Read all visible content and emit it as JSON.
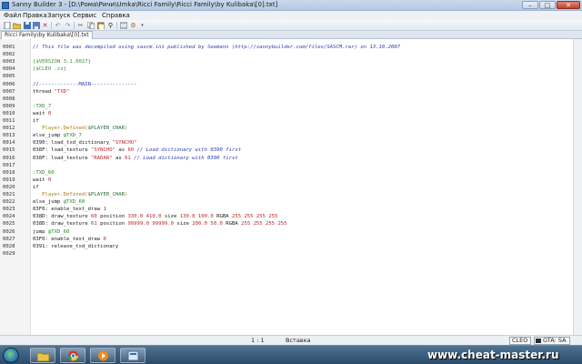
{
  "window": {
    "title": "Sanny Builder 3 - [D:\\Рома\\Ричи\\Umka\\Ricci Family\\Ricci Family\\by Kulibaka\\[0].txt]"
  },
  "menu": [
    "Файл",
    "Правка",
    "Запуск",
    "Сервис",
    "Справка"
  ],
  "tab": {
    "label": "Ricci Family\\by Kulibaka\\[0].txt"
  },
  "colors": {
    "comment": "#2a3fb0",
    "directive": "#3f8f3f",
    "label": "#2a8a2a",
    "string": "#c0262c",
    "class": "#b07a12"
  },
  "code_lines": [
    {
      "num": "0001",
      "segments": [
        {
          "t": "// This file was decompiled using sascm.ini published by Seemann (http://sannybuilder.com/files/SASCM.rar) on 13.10.2007",
          "c": "comment"
        }
      ]
    },
    {
      "num": "0002",
      "segments": []
    },
    {
      "num": "0003",
      "segments": [
        {
          "t": "{$VERSION 3.1.0027}",
          "c": "directive"
        }
      ]
    },
    {
      "num": "0004",
      "segments": [
        {
          "t": "{$CLEO .cs}",
          "c": "directive"
        }
      ]
    },
    {
      "num": "0005",
      "segments": []
    },
    {
      "num": "0006",
      "segments": [
        {
          "t": "//-------------MAIN---------------",
          "c": "sep"
        }
      ]
    },
    {
      "num": "0007",
      "segments": [
        {
          "t": "thread ",
          "c": "plain"
        },
        {
          "t": "\"TXD\"",
          "c": "string"
        }
      ]
    },
    {
      "num": "0008",
      "segments": []
    },
    {
      "num": "0009",
      "segments": [
        {
          "t": ":TXD_7",
          "c": "label"
        }
      ]
    },
    {
      "num": "0010",
      "segments": [
        {
          "t": "wait ",
          "c": "plain"
        },
        {
          "t": "0",
          "c": "number"
        }
      ]
    },
    {
      "num": "0011",
      "segments": [
        {
          "t": "if",
          "c": "plain"
        }
      ]
    },
    {
      "num": "0012",
      "segments": [
        {
          "t": "   Player.Defined(",
          "c": "class"
        },
        {
          "t": "$PLAYER_CHAR",
          "c": "var"
        },
        {
          "t": ")",
          "c": "class"
        }
      ]
    },
    {
      "num": "0013",
      "segments": [
        {
          "t": "else_jump ",
          "c": "plain"
        },
        {
          "t": "@TXD_7",
          "c": "label"
        }
      ]
    },
    {
      "num": "0014",
      "segments": [
        {
          "t": "0390: load_txd_dictionary ",
          "c": "plain"
        },
        {
          "t": "\"SYNCHO\"",
          "c": "string"
        }
      ]
    },
    {
      "num": "0015",
      "segments": [
        {
          "t": "038F: load_texture ",
          "c": "plain"
        },
        {
          "t": "\"SYNCHO\"",
          "c": "string"
        },
        {
          "t": " as ",
          "c": "plain"
        },
        {
          "t": "60",
          "c": "number"
        },
        {
          "t": " // Load dictionary with 0390 first",
          "c": "comment"
        }
      ]
    },
    {
      "num": "0016",
      "segments": [
        {
          "t": "038F: load_texture ",
          "c": "plain"
        },
        {
          "t": "\"RADAR\"",
          "c": "string"
        },
        {
          "t": " as ",
          "c": "plain"
        },
        {
          "t": "61",
          "c": "number"
        },
        {
          "t": " // Load dictionary with 0390 first",
          "c": "comment"
        }
      ]
    },
    {
      "num": "0017",
      "segments": []
    },
    {
      "num": "0018",
      "segments": [
        {
          "t": ":TXD_60",
          "c": "label"
        }
      ]
    },
    {
      "num": "0019",
      "segments": [
        {
          "t": "wait ",
          "c": "plain"
        },
        {
          "t": "0",
          "c": "number"
        }
      ]
    },
    {
      "num": "0020",
      "segments": [
        {
          "t": "if",
          "c": "plain"
        }
      ]
    },
    {
      "num": "0021",
      "segments": [
        {
          "t": "   Player.Defined(",
          "c": "class"
        },
        {
          "t": "$PLAYER_CHAR",
          "c": "var"
        },
        {
          "t": ")",
          "c": "class"
        }
      ]
    },
    {
      "num": "0022",
      "segments": [
        {
          "t": "else_jump ",
          "c": "plain"
        },
        {
          "t": "@TXD_60",
          "c": "label"
        }
      ]
    },
    {
      "num": "0023",
      "segments": [
        {
          "t": "03F0: enable_text_draw ",
          "c": "plain"
        },
        {
          "t": "1",
          "c": "number"
        }
      ]
    },
    {
      "num": "0024",
      "segments": [
        {
          "t": "038D: draw_texture ",
          "c": "plain"
        },
        {
          "t": "60",
          "c": "number"
        },
        {
          "t": " position ",
          "c": "plain"
        },
        {
          "t": "330.0 410.0",
          "c": "number"
        },
        {
          "t": " size ",
          "c": "plain"
        },
        {
          "t": "130.0 100.0",
          "c": "number"
        },
        {
          "t": " RGBA ",
          "c": "plain"
        },
        {
          "t": "255 255 255 255",
          "c": "number"
        }
      ]
    },
    {
      "num": "0025",
      "segments": [
        {
          "t": "038D: draw_texture ",
          "c": "plain"
        },
        {
          "t": "61",
          "c": "number"
        },
        {
          "t": " position ",
          "c": "plain"
        },
        {
          "t": "99999.0 99999.0",
          "c": "number"
        },
        {
          "t": " size ",
          "c": "plain"
        },
        {
          "t": "200.0 50.0",
          "c": "number"
        },
        {
          "t": " RGBA ",
          "c": "plain"
        },
        {
          "t": "255 255 255 255",
          "c": "number"
        }
      ]
    },
    {
      "num": "0026",
      "segments": [
        {
          "t": "jump ",
          "c": "plain"
        },
        {
          "t": "@TXD_60",
          "c": "label"
        }
      ]
    },
    {
      "num": "0027",
      "segments": [
        {
          "t": "03F0: enable_text_draw ",
          "c": "plain"
        },
        {
          "t": "0",
          "c": "number"
        }
      ]
    },
    {
      "num": "0028",
      "segments": [
        {
          "t": "0391: release_txd_dictionary",
          "c": "plain"
        }
      ]
    },
    {
      "num": "0029",
      "segments": []
    }
  ],
  "status": {
    "cursor": "1 : 1",
    "mode": "Вставка",
    "format": "CLEO",
    "game": "GTA: SA"
  },
  "watermark": "www.cheat-master.ru"
}
